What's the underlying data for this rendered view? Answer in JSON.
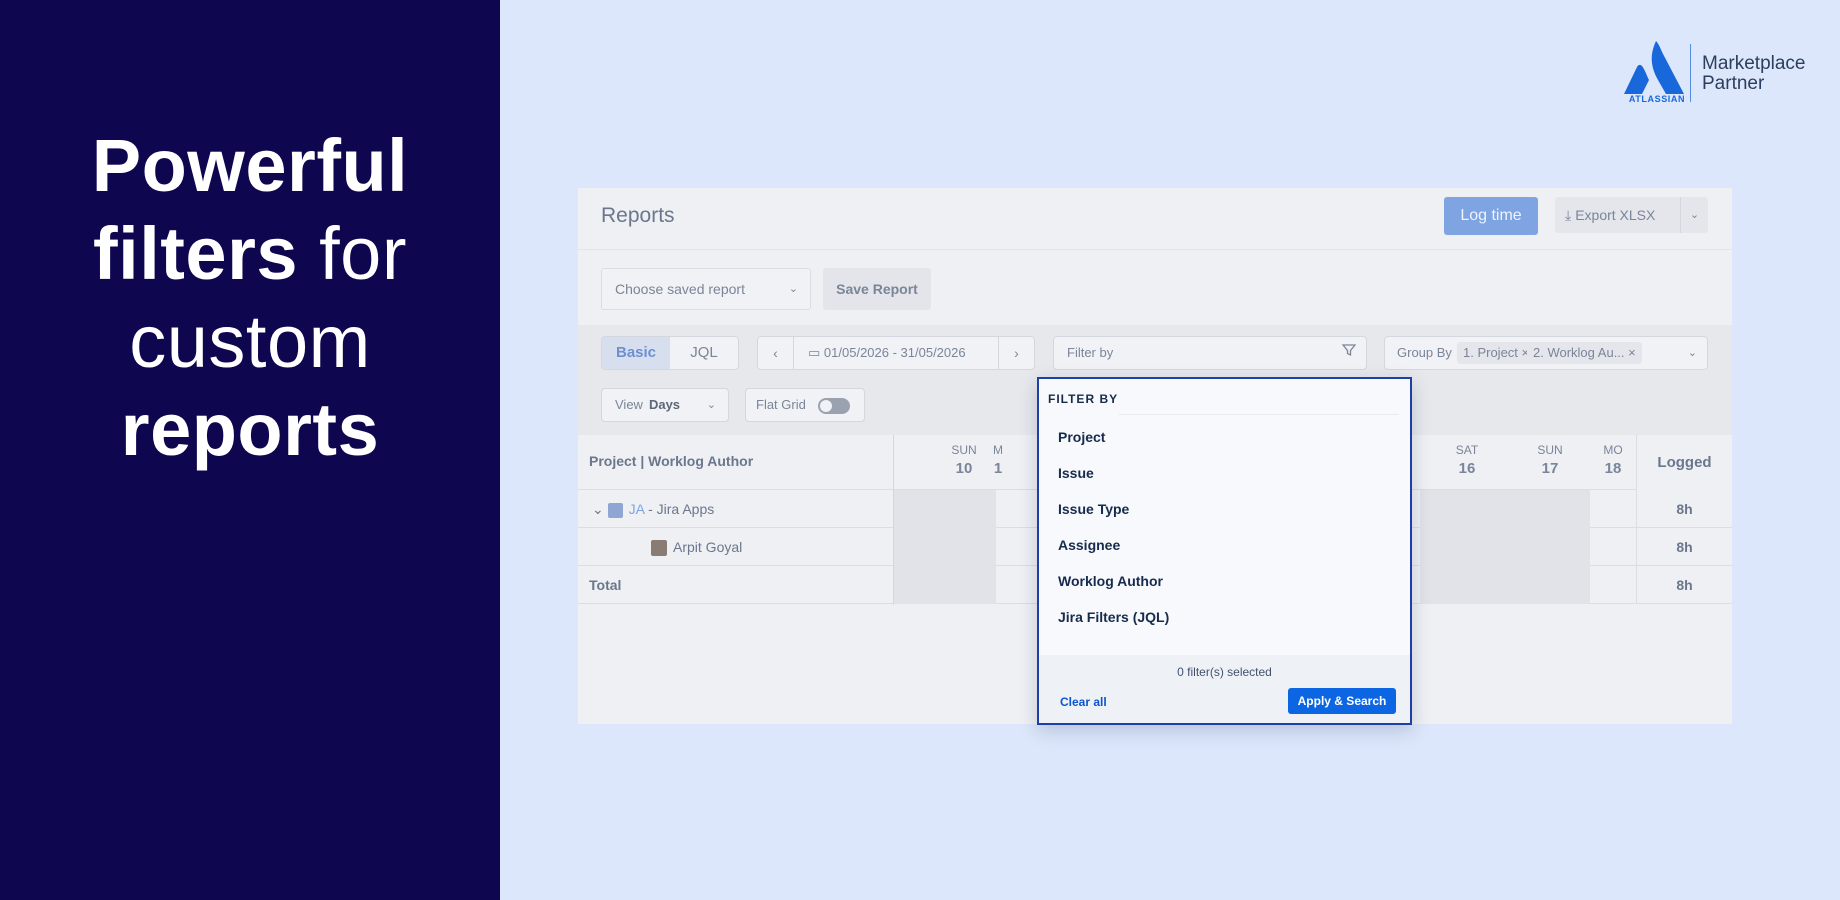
{
  "hero": {
    "line1_bold": "Powerful",
    "line2_bold": "filters",
    "line2_regular": "for",
    "line3_regular": "custom",
    "line4_bold": "reports"
  },
  "badge": {
    "wordmark": "ATLASSIAN",
    "line1": "Marketplace",
    "line2": "Partner",
    "brand_color": "#1868DB"
  },
  "app": {
    "title": "Reports",
    "log_time_label": "Log time",
    "export_label": "Export XLSX",
    "saved_report_placeholder": "Choose saved report",
    "save_report_label": "Save Report",
    "mode_tabs": [
      "Basic",
      "JQL"
    ],
    "date_range": "01/05/2026 - 31/05/2026",
    "filter_by_placeholder": "Filter by",
    "group_by": {
      "label": "Group By",
      "chips": [
        "1. Project",
        "2. Worklog Au..."
      ]
    },
    "view": {
      "label": "View",
      "value": "Days"
    },
    "flat_grid_label": "Flat Grid",
    "flat_grid_on": false
  },
  "table": {
    "first_col_header": "Project | Worklog Author",
    "days": [
      {
        "dow": "SUN",
        "date": "10"
      },
      {
        "dow": "M",
        "date": "1"
      },
      {
        "dow": "SAT",
        "date": "16"
      },
      {
        "dow": "SUN",
        "date": "17"
      },
      {
        "dow": "MO",
        "date": "18"
      }
    ],
    "logged_header": "Logged",
    "rows": [
      {
        "code": "JA",
        "label": "- Jira Apps",
        "logged": "8h"
      },
      {
        "label": "Arpit Goyal",
        "logged": "8h"
      },
      {
        "label": "Total",
        "logged": "8h"
      }
    ]
  },
  "filter_popup": {
    "heading": "FILTER BY",
    "options": [
      "Project",
      "Issue",
      "Issue Type",
      "Assignee",
      "Worklog Author",
      "Jira Filters (JQL)"
    ],
    "selected_count_text": "0 filter(s) selected",
    "clear_label": "Clear all",
    "apply_label": "Apply & Search",
    "accent_color": "#0C66E4",
    "border_color": "#1D3FA8"
  }
}
